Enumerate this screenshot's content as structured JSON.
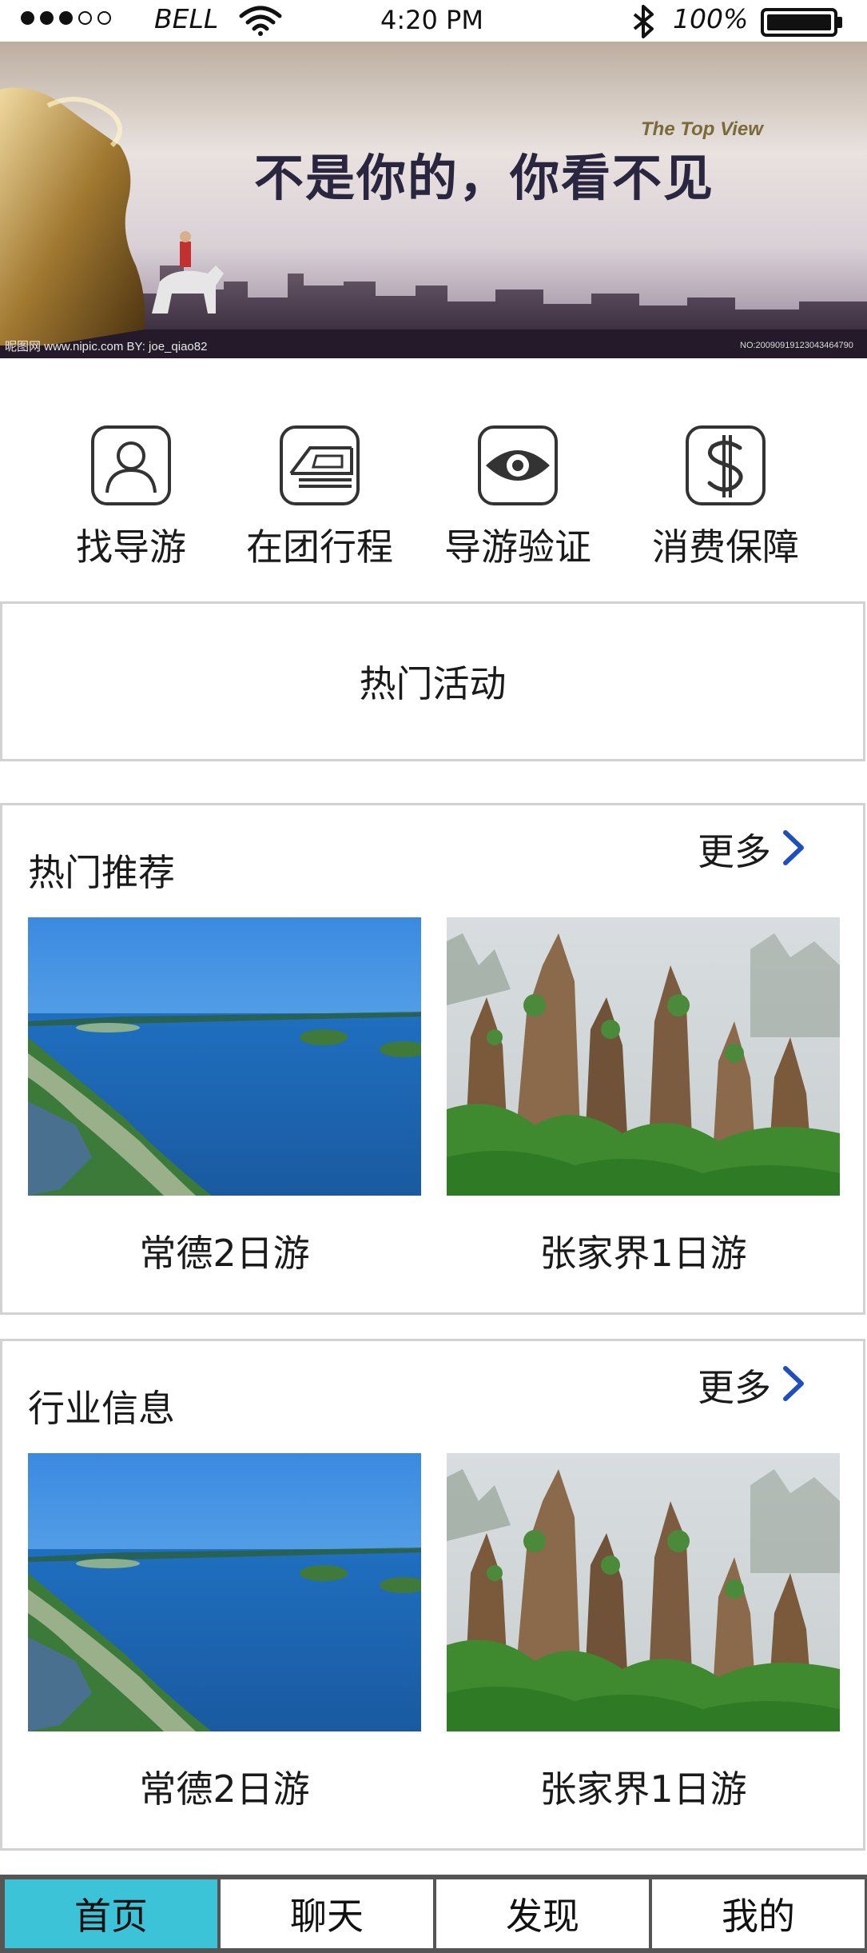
{
  "status_bar": {
    "carrier": "BELL",
    "time": "4:20 PM",
    "battery": "100%"
  },
  "banner": {
    "slogan": "不是你的，你看不见",
    "subtitle": "The Top View",
    "credit": "昵图网 www.nipic.com   BY: joe_qiao82",
    "image_id": "NO:20090919123043464790"
  },
  "quick_links": [
    {
      "label": "找导游",
      "icon": "guide-person-icon"
    },
    {
      "label": "在团行程",
      "icon": "itinerary-icon"
    },
    {
      "label": "导游验证",
      "icon": "eye-icon"
    },
    {
      "label": "消费保障",
      "icon": "dollar-icon"
    }
  ],
  "hot_activities": {
    "label": "热门活动"
  },
  "recommend": {
    "title": "热门推荐",
    "more": "更多",
    "cards": [
      {
        "caption": "常德2日游"
      },
      {
        "caption": "张家界1日游"
      }
    ]
  },
  "industry": {
    "title": "行业信息",
    "more": "更多",
    "cards": [
      {
        "caption": "常德2日游"
      },
      {
        "caption": "张家界1日游"
      }
    ]
  },
  "tabs": [
    {
      "label": "首页",
      "active": true
    },
    {
      "label": "聊天",
      "active": false
    },
    {
      "label": "发现",
      "active": false
    },
    {
      "label": "我的",
      "active": false
    }
  ],
  "colors": {
    "tab_active": "#3cc3d8",
    "chevron": "#1f4fbf",
    "border": "#d2d2d2"
  }
}
